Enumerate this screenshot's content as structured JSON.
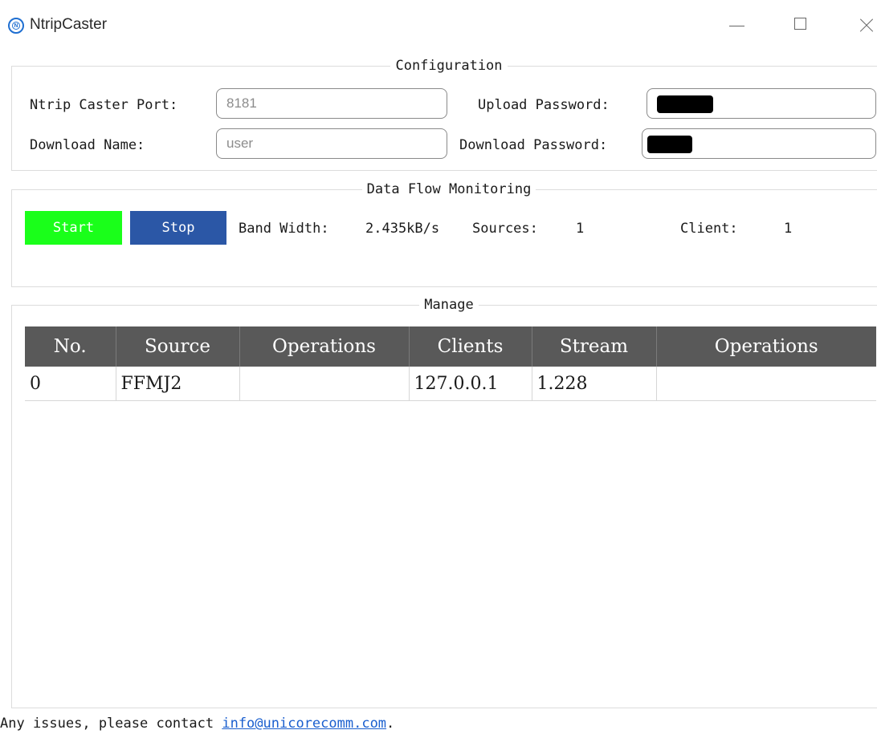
{
  "window": {
    "title": "NtripCaster",
    "icon": "ntrip-logo-icon",
    "controls": [
      "minimize-icon",
      "maximize-icon",
      "close-icon"
    ]
  },
  "configuration": {
    "title": "Configuration",
    "port_label": "Ntrip Caster Port:",
    "port_value": "8181",
    "upload_password_label": "Upload Password:",
    "upload_password_value": "",
    "download_name_label": "Download Name:",
    "download_name_value": "user",
    "download_password_label": "Download Password:",
    "download_password_value": ""
  },
  "monitoring": {
    "title": "Data Flow Monitoring",
    "start_label": "Start",
    "stop_label": "Stop",
    "bandwidth_label": "Band Width:",
    "bandwidth_value": "2.435kB/s",
    "sources_label": "Sources:",
    "sources_value": "1",
    "client_label": "Client:",
    "client_value": "1"
  },
  "manage": {
    "title": "Manage",
    "columns": [
      "No.",
      "Source",
      "Operations",
      "Clients",
      "Stream",
      "Operations"
    ],
    "rows": [
      [
        "0",
        "FFMJ2",
        "",
        "127.0.0.1",
        "1.228",
        ""
      ]
    ]
  },
  "footer": {
    "text": "Any issues, please contact ",
    "email": "info@unicorecomm.com",
    "suffix": "."
  },
  "colors": {
    "start_button": "#1aff1a",
    "stop_button": "#2b57a6",
    "table_header": "#595959",
    "link": "#1a5fcf"
  }
}
